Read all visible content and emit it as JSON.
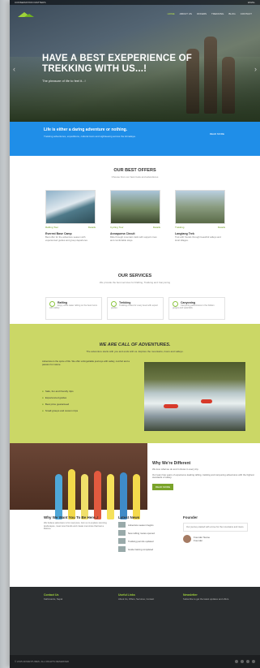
{
  "topbar": {
    "left": "CONSERVATION MATTERS",
    "right": "EMAIL"
  },
  "nav": {
    "items": [
      "HOME",
      "ABOUT US",
      "OFFERS",
      "TREKKING",
      "BLOG",
      "CONTACT"
    ]
  },
  "hero": {
    "title": "HAVE A BEST EXEPERIENCE OF TREKKING WITH US...!",
    "subtitle": "The pleasure of life to feel it...!"
  },
  "blue": {
    "heading": "Life is either a daring adventure or nothing.",
    "text": "Trekking adventures, expeditions, cultural tours and sightseeing across the Himalaya.",
    "button": "READ MORE"
  },
  "offers": {
    "title": "OUR BEST OFFERS",
    "subtitle": "Choose from our best treks and adventures",
    "items": [
      {
        "name": "Everest Base Camp",
        "left": "Rafting Tour",
        "right": "Details",
        "desc": "Best offer for the adventure season with experienced guides and group departures."
      },
      {
        "name": "Annapurna Circuit",
        "left": "Cycling Tour",
        "right": "Details",
        "desc": "Ride through mountain trails with support crew and comfortable stays."
      },
      {
        "name": "Langtang Trek",
        "left": "Trekking",
        "right": "Details",
        "desc": "Trek with friends through beautiful valleys and local villages."
      }
    ]
  },
  "services": {
    "title": "OUR SERVICES",
    "subtitle": "We provide the best services for Rafting, Trekking and Canyoning",
    "items": [
      {
        "name": "Rafting",
        "desc": "Enjoy white water rafting on the best rivers with safety."
      },
      {
        "name": "Trekking",
        "desc": "Trekking routes for every level with expert guides."
      },
      {
        "name": "Canyoning",
        "desc": "Canyoning adventures in the hidden gorges and waterfalls."
      }
    ]
  },
  "green": {
    "title": "WE ARE CALL OF ADVENTURES.",
    "subtitle": "The adventure starts with you and ends with us. Explore the mountains, rivers and valleys.",
    "text": "Adventure is the spice of life. We offer unforgettable journeys with safety, comfort and a passion for nature.",
    "items": [
      "Safe, fun and friendly trips",
      "Experienced guides",
      "Best price guaranteed",
      "Small groups and custom trips"
    ]
  },
  "different": {
    "title": "Why We're Different",
    "text1": "We love what we do and it shows in every trip.",
    "text2": "Our team has years of experience leading rafting, trekking and canyoning adventures with the highest standards of safety.",
    "button": "READ MORE"
  },
  "why": {
    "title": "Why We Want You To Be Here..!",
    "text": "We believe adventure is for everyone. Join us to explore stunning landscapes, meet new friends and create memories that last a lifetime."
  },
  "news": {
    "title": "Latest News",
    "items": [
      "Adventure season begins",
      "New rafting routes opened",
      "Trekking permits updated",
      "Guide training completed"
    ]
  },
  "founder": {
    "title": "Founder",
    "text": "Our journey started with a love for the mountains and rivers.",
    "name": "Founder Name",
    "role": "Founder"
  },
  "footer": {
    "col1": {
      "title": "Contact Us",
      "text": "Kathmandu, Nepal"
    },
    "col2": {
      "title": "Useful Links",
      "text": "About Us, Offers, Services, Contact"
    },
    "col3": {
      "title": "Newsletter",
      "text": "Subscribe to get the latest updates and offers."
    },
    "copyright": "© 2015 ADVENTURES. ALL RIGHTS RESERVED"
  }
}
